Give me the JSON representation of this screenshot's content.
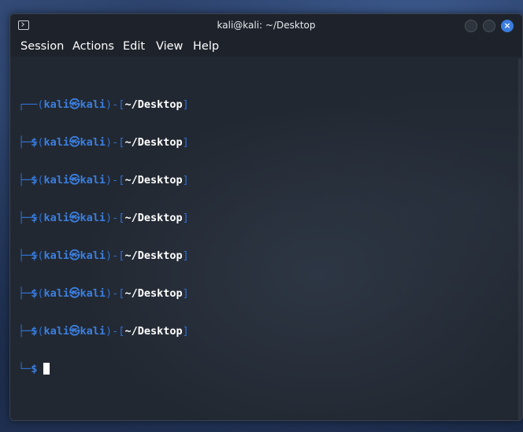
{
  "window": {
    "title": "kali@kali: ~/Desktop",
    "close_glyph": "×"
  },
  "menu": {
    "items": [
      "Session",
      "Actions",
      "Edit",
      "View",
      "Help"
    ]
  },
  "terminal": {
    "prompt": {
      "open": "┌──(",
      "user": "kali",
      "at": "㉿",
      "host": "kali",
      "mid": ")-[",
      "path": "~/Desktop",
      "close": "]",
      "line2_prefix": "└─",
      "dollar": "$"
    },
    "prompt_count": 7
  },
  "colors": {
    "accent": "#3b7fe0",
    "close_button": "#3b7ddd",
    "background": "#222831"
  }
}
